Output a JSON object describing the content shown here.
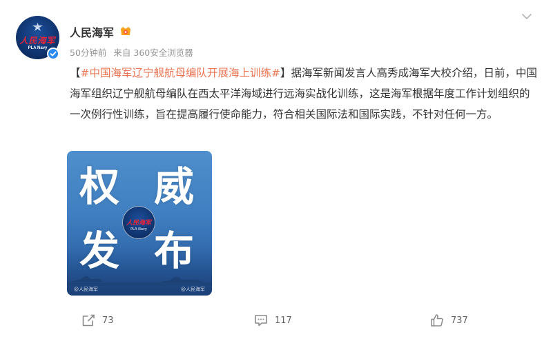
{
  "account": {
    "name": "人民海军",
    "avatar_text": "人民海军",
    "avatar_sub": "PLA Navy",
    "verified": true
  },
  "meta": {
    "time": "50分钟前",
    "source": "来自 360安全浏览器"
  },
  "post": {
    "bracket_open": "【",
    "topic": "#中国海军辽宁舰航母编队开展海上训练#",
    "bracket_close": "】",
    "body": "据海军新闻发言人高秀成海军大校介绍，日前，中国海军组织辽宁舰航母编队在西太平洋海域进行远海实战化训练，这是海军根据年度工作计划组织的一次例行性训练，旨在提高履行使命能力，符合相关国际法和国际实践，不针对任何一方。"
  },
  "image": {
    "chars": [
      "权",
      "威",
      "发",
      "布"
    ],
    "emblem_text": "人民海军",
    "emblem_sub": "PLA Navy",
    "watermark_left": "@人民海军",
    "watermark_right": "@人民海军"
  },
  "actions": {
    "share_count": "73",
    "comment_count": "117",
    "like_count": "737"
  },
  "colors": {
    "topic": "#eb7350",
    "verified": "#2a8cf2",
    "meta": "#939393"
  }
}
